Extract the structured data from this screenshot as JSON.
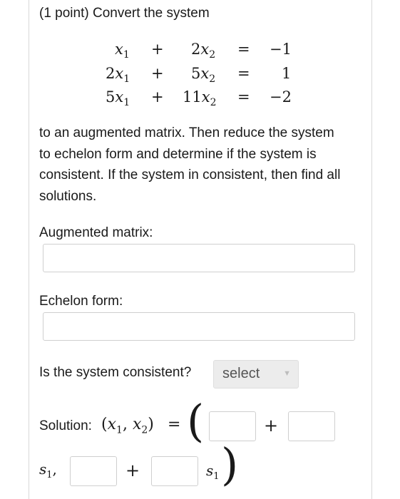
{
  "problem": {
    "header": "(1 point) Convert the system",
    "system": [
      {
        "a": "x",
        "a_sub": "1",
        "a_coef": "",
        "op": "+",
        "b_coef": "2",
        "b": "x",
        "b_sub": "2",
        "eq": "=",
        "rhs": "−1"
      },
      {
        "a": "x",
        "a_sub": "1",
        "a_coef": "2",
        "op": "+",
        "b_coef": "5",
        "b": "x",
        "b_sub": "2",
        "eq": "=",
        "rhs": "1"
      },
      {
        "a": "x",
        "a_sub": "1",
        "a_coef": "5",
        "op": "+",
        "b_coef": "11",
        "b": "x",
        "b_sub": "2",
        "eq": "=",
        "rhs": "−2"
      }
    ],
    "instructions": "to an augmented matrix. Then reduce the system to echelon form and determine if the system is consistent. If the system in consistent, then find all solutions."
  },
  "augmented": {
    "label": "Augmented matrix:",
    "value": ""
  },
  "echelon": {
    "label": "Echelon form:",
    "value": ""
  },
  "consistent": {
    "label": "Is the system consistent?",
    "select_value": "select"
  },
  "solution": {
    "label": "Solution:",
    "lhs_open": "(",
    "x1": "x",
    "x1_sub": "1",
    "comma": ",",
    "x2": "x",
    "x2_sub": "2",
    "lhs_close": ")",
    "equals": "=",
    "plus": "+",
    "param": "s",
    "param_sub": "1",
    "param_comma": ","
  }
}
